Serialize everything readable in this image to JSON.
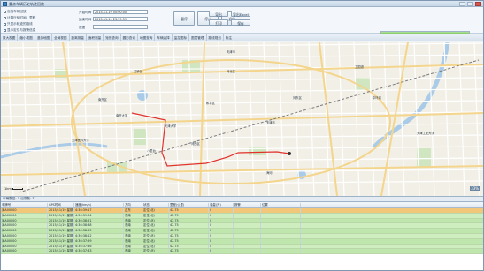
{
  "window": {
    "title": "重点车辆历史轨迹回放"
  },
  "controls": {
    "options": [
      "包括车辆回放",
      "计算行驶时间、里程",
      "只显示轨迹的路线",
      "显示定位与报警信息"
    ],
    "start_time_label": "开始时间",
    "end_time_label": "结束时间",
    "start_time_value": "2015-11-19 00:00:00",
    "end_time_value": "2015-11-19 23:59:59",
    "speed_label": "速度",
    "buttons": {
      "pause": "暂停",
      "stop": "停止",
      "exit": "退出",
      "export": "导出",
      "export_excel": "导出Excel",
      "print": "打印",
      "save": "保存",
      "clear": "清除"
    },
    "playback_progress": 1.0
  },
  "toolbar": {
    "tabs": [
      "放大视图",
      "缩小视图",
      "漫游地图",
      "全局视图",
      "距离测量",
      "面积测量",
      "矩形查询",
      "圆形查询",
      "地图查询",
      "车辆选择",
      "监控图标",
      "图层管理",
      "路线规划",
      "标注"
    ]
  },
  "map": {
    "labels": [
      "天津市",
      "南开区",
      "和平区",
      "河西区",
      "河东区",
      "河北区",
      "红桥区",
      "天津大学",
      "南开大学",
      "天津站",
      "八里台",
      "中环线",
      "卫国道",
      "海河",
      "天津工业大学",
      "天津医科大学"
    ],
    "scale_label": "1km",
    "corner_label": "33%"
  },
  "statusbar": {
    "text": "车辆数量: 1  记录数: 7"
  },
  "grid": {
    "columns": [
      "车牌号",
      "GPS时间",
      "速度(km/h)",
      "方向",
      "状态",
      "里程(公里)",
      "油量(升)",
      "报警",
      "位置"
    ],
    "rows": [
      [
        "津A00000",
        "2015/11/19 星期四",
        "4:36:39:17",
        "正东",
        "定位(北)",
        "42.75",
        "0",
        "",
        ""
      ],
      [
        "津A00000",
        "2015/11/19 星期四",
        "4:36:39:04",
        "东南",
        "定位(北)",
        "42.75",
        "0",
        "",
        ""
      ],
      [
        "津A00000",
        "2015/11/19 星期四",
        "4:36:38:51",
        "东南",
        "定位(北)",
        "42.75",
        "0",
        "",
        ""
      ],
      [
        "津A00000",
        "2015/11/19 星期四",
        "4:36:38:38",
        "东南",
        "定位(北)",
        "42.75",
        "0",
        "",
        ""
      ],
      [
        "津A00000",
        "2015/11/19 星期四",
        "4:36:38:25",
        "东南",
        "定位(北)",
        "42.75",
        "0",
        "",
        ""
      ],
      [
        "津A00000",
        "2015/11/19 星期四",
        "4:36:38:12",
        "东南",
        "定位(北)",
        "42.75",
        "0",
        "",
        ""
      ],
      [
        "津A00000",
        "2015/11/19 星期四",
        "4:36:37:59",
        "东南",
        "定位(北)",
        "42.75",
        "0",
        "",
        ""
      ],
      [
        "津A00000",
        "2015/11/19 星期四",
        "4:36:37:46",
        "东南",
        "定位(北)",
        "42.75",
        "0",
        "",
        ""
      ],
      [
        "津A00000",
        "2015/11/19 星期四",
        "4:36:37:33",
        "东南",
        "定位(北)",
        "42.75",
        "0",
        "",
        ""
      ]
    ]
  },
  "colors": {
    "accent": "#3c82c8",
    "track": "#e0332c",
    "selected_row": "#f3c779",
    "row_green": "#cfeec0"
  }
}
